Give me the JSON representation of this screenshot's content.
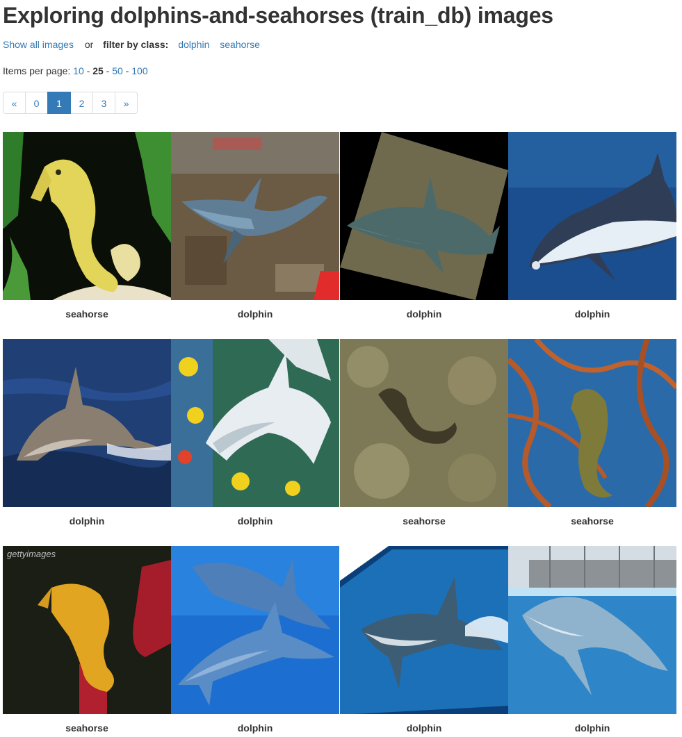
{
  "header": {
    "title": "Exploring dolphins-and-seahorses (train_db) images"
  },
  "filters": {
    "show_all_label": "Show all images",
    "or_text": "or",
    "filter_by_label": "filter by class:",
    "classes": [
      "dolphin",
      "seahorse"
    ]
  },
  "per_page": {
    "label": "Items per page:",
    "options": [
      "10",
      "25",
      "50",
      "100"
    ],
    "selected": "25"
  },
  "pagination": {
    "prev": "«",
    "next": "»",
    "pages": [
      "0",
      "1",
      "2",
      "3"
    ],
    "active_page": "1"
  },
  "images": [
    {
      "label": "seahorse",
      "icon": "seahorse-photo"
    },
    {
      "label": "dolphin",
      "icon": "dolphin-photo"
    },
    {
      "label": "dolphin",
      "icon": "dolphin-photo"
    },
    {
      "label": "dolphin",
      "icon": "dolphin-photo"
    },
    {
      "label": "dolphin",
      "icon": "dolphin-photo"
    },
    {
      "label": "dolphin",
      "icon": "dolphin-photo"
    },
    {
      "label": "seahorse",
      "icon": "seahorse-photo"
    },
    {
      "label": "seahorse",
      "icon": "seahorse-photo"
    },
    {
      "label": "seahorse",
      "icon": "seahorse-photo",
      "watermark": "gettyimages"
    },
    {
      "label": "dolphin",
      "icon": "dolphin-photo"
    },
    {
      "label": "dolphin",
      "icon": "dolphin-photo"
    },
    {
      "label": "dolphin",
      "icon": "dolphin-photo"
    }
  ],
  "colors": {
    "link": "#337ab7",
    "active_page_bg": "#337ab7",
    "text": "#333333"
  }
}
